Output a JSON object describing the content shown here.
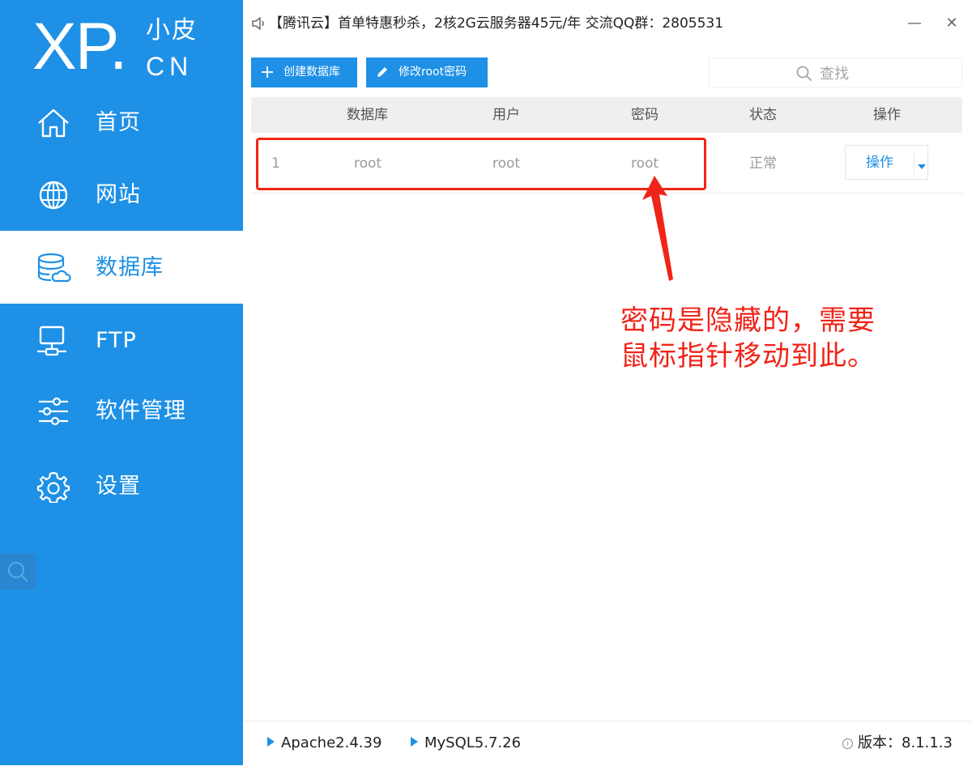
{
  "brand": {
    "logo_main": "XP.",
    "logo_cn": "小皮",
    "logo_domain": "CN"
  },
  "sidebar": {
    "items": [
      {
        "label": "首页",
        "icon": "home-icon",
        "active": false
      },
      {
        "label": "网站",
        "icon": "globe-icon",
        "active": false
      },
      {
        "label": "数据库",
        "icon": "database-icon",
        "active": true
      },
      {
        "label": "FTP",
        "icon": "server-icon",
        "active": false
      },
      {
        "label": "软件管理",
        "icon": "sliders-icon",
        "active": false
      },
      {
        "label": "设置",
        "icon": "gear-icon",
        "active": false
      }
    ]
  },
  "topbar": {
    "announcement": "【腾讯云】首单特惠秒杀，2核2G云服务器45元/年 交流QQ群：2805531",
    "minimize": "—",
    "close": "✕"
  },
  "toolbar": {
    "create_db_label": "创建数据库",
    "change_root_pwd_label": "修改root密码",
    "search_placeholder": "查找"
  },
  "table": {
    "columns": [
      "数据库",
      "用户",
      "密码",
      "状态",
      "操作"
    ],
    "rows": [
      {
        "index": "1",
        "database": "root",
        "user": "root",
        "password": "root",
        "status": "正常",
        "action": "操作"
      }
    ]
  },
  "annotation": {
    "line1": "密码是隐藏的，需要",
    "line2": "鼠标指针移动到此。"
  },
  "statusbar": {
    "apache": "Apache2.4.39",
    "mysql": "MySQL5.7.26",
    "version_label": "版本：",
    "version": "8.1.1.3"
  },
  "colors": {
    "brand_blue": "#1e90e6",
    "annotation_red": "#f02418"
  }
}
